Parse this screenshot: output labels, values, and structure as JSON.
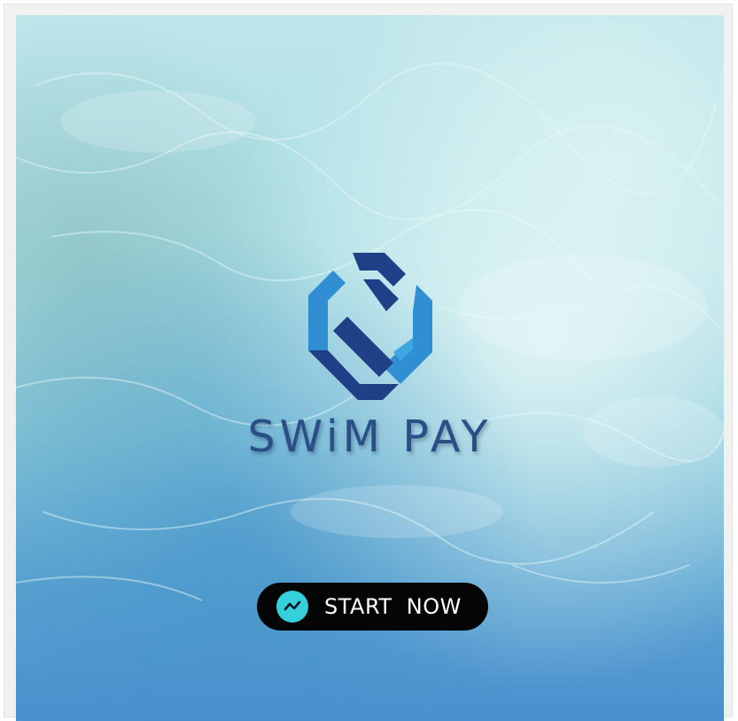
{
  "app": {
    "brand_name": "SWiM PAY",
    "cta_label": "START  NOW"
  },
  "colors": {
    "brand_text": "#2a4f86",
    "logo_dark": "#1f3f86",
    "logo_light": "#2f8fd2",
    "cta_background": "#050505",
    "cta_icon_circle": "#35d0dc",
    "cta_text": "#ffffff"
  },
  "icons": {
    "logo": "swim-pay-logo-icon",
    "cta": "trend-line-icon"
  }
}
